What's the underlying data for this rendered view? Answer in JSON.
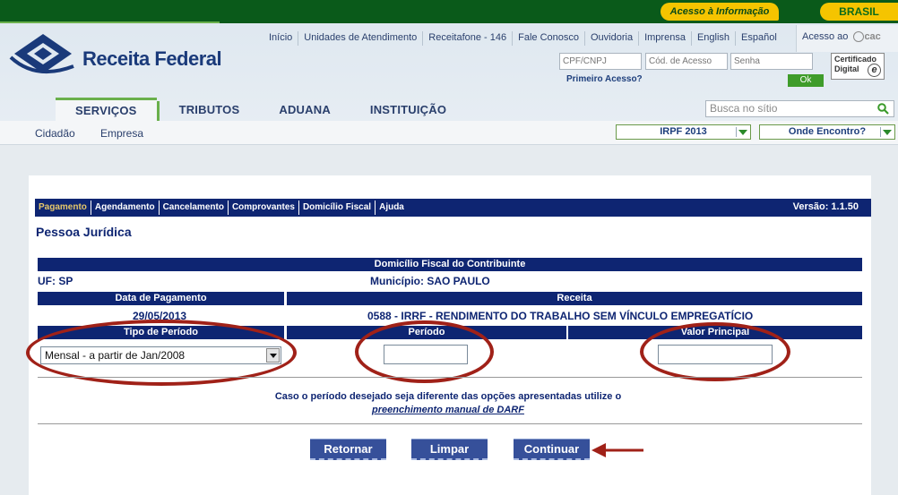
{
  "govbar": {
    "acesso_informacao": "Acesso à Informação",
    "brasil": "BRASIL"
  },
  "header": {
    "logo_text": "Receita Federal",
    "top_links": [
      "Início",
      "Unidades de Atendimento",
      "Receitafone - 146",
      "Fale Conosco",
      "Ouvidoria",
      "Imprensa",
      "English",
      "Español"
    ],
    "acesso_ecac_label": "Acesso ao",
    "ecac_suffix": "cac",
    "login": {
      "cpf_placeholder": "CPF/CNPJ",
      "codigo_placeholder": "Cód. de Acesso",
      "senha_placeholder": "Senha",
      "primeiro_acesso": "Primeiro Acesso?",
      "ok_label": "Ok",
      "certificado": "Certificado Digital",
      "certificado_e": "e"
    },
    "menu_tabs": [
      "SERVIÇOS",
      "TRIBUTOS",
      "ADUANA",
      "INSTITUIÇÃO"
    ],
    "search_placeholder": "Busca no sítio",
    "sub_links": [
      "Cidadão",
      "Empresa"
    ],
    "select_irpf": "IRPF 2013",
    "select_onde": "Onde Encontro?"
  },
  "app": {
    "nav": [
      "Pagamento",
      "Agendamento",
      "Cancelamento",
      "Comprovantes",
      "Domicílio Fiscal",
      "Ajuda"
    ],
    "versao": "Versão: 1.1.50",
    "title": "Pessoa Jurídica",
    "domicilio_header": "Domicílio Fiscal do Contribuinte",
    "uf": "UF: SP",
    "municipio": "Município: SAO PAULO",
    "data_pagamento_header": "Data de Pagamento",
    "data_pagamento": "29/05/2013",
    "receita_header": "Receita",
    "receita": "0588 - IRRF - RENDIMENTO DO TRABALHO SEM VÍNCULO EMPREGATÍCIO",
    "tipo_periodo_header": "Tipo de Período",
    "tipo_periodo_value": "Mensal - a partir de Jan/2008",
    "periodo_header": "Período",
    "periodo_value": "",
    "valor_header": "Valor Principal",
    "valor_value": "",
    "info_line1": "Caso o período desejado seja diferente das opções apresentadas utilize o",
    "info_link": "preenchimento manual de DARF",
    "buttons": {
      "retornar": "Retornar",
      "limpar": "Limpar",
      "continuar": "Continuar"
    }
  },
  "colors": {
    "navy": "#0e2572",
    "annotation_red": "#a02118",
    "gov_green": "#0a5a1a",
    "gov_yellow": "#f5c400"
  }
}
